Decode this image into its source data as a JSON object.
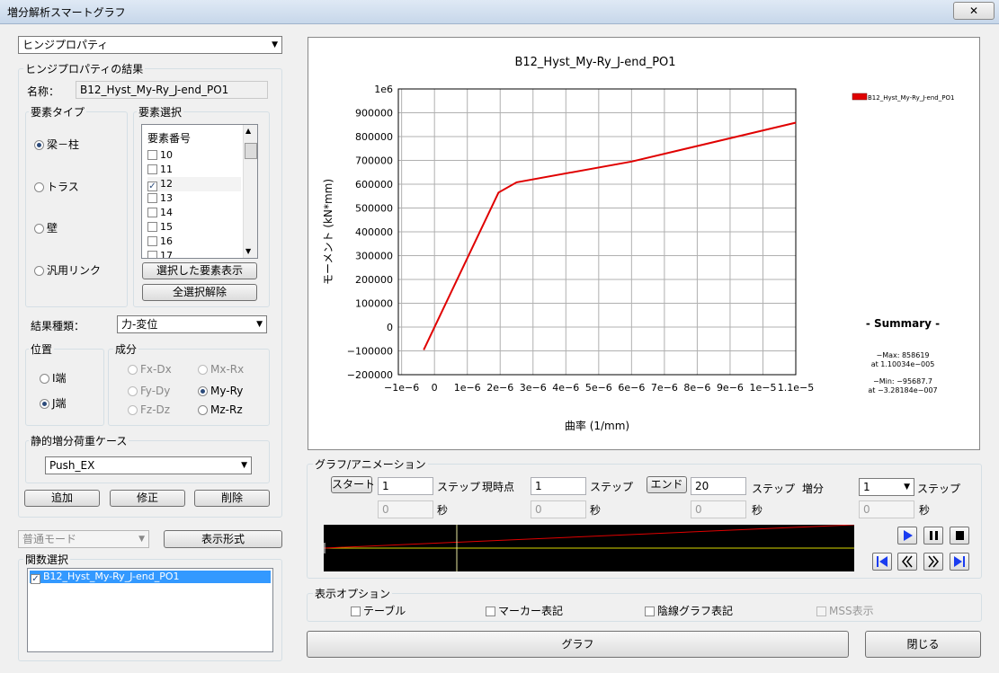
{
  "window": {
    "title": "増分解析スマートグラフ",
    "close": "✕"
  },
  "left": {
    "type_selector": "ヒンジプロパティ",
    "results_group": "ヒンジプロパティの結果",
    "name_label": "名称：",
    "name_value": "B12_Hyst_My-Ry_J-end_PO1",
    "element_type_group": "要素タイプ",
    "element_types": [
      {
        "label": "梁－柱",
        "selected": true
      },
      {
        "label": "トラス",
        "selected": false
      },
      {
        "label": "壁",
        "selected": false
      },
      {
        "label": "汎用リンク",
        "selected": false
      }
    ],
    "element_select_group": "要素選択",
    "element_list_header": "要素番号",
    "element_list": [
      {
        "num": "10",
        "checked": false
      },
      {
        "num": "11",
        "checked": false
      },
      {
        "num": "12",
        "checked": true
      },
      {
        "num": "13",
        "checked": false
      },
      {
        "num": "14",
        "checked": false
      },
      {
        "num": "15",
        "checked": false
      },
      {
        "num": "16",
        "checked": false
      },
      {
        "num": "17",
        "checked": false
      }
    ],
    "show_selected_btn": "選択した要素表示",
    "clear_all_btn": "全選択解除",
    "result_kind_label": "結果種類：",
    "result_kind_value": "力-変位",
    "position_group": "位置",
    "positions": [
      {
        "label": "I端",
        "selected": false
      },
      {
        "label": "J端",
        "selected": true
      }
    ],
    "component_group": "成分",
    "components": [
      {
        "label": "Fx-Dx",
        "selected": false,
        "enabled": false
      },
      {
        "label": "Mx-Rx",
        "selected": false,
        "enabled": false
      },
      {
        "label": "Fy-Dy",
        "selected": false,
        "enabled": false
      },
      {
        "label": "My-Ry",
        "selected": true,
        "enabled": true
      },
      {
        "label": "Fz-Dz",
        "selected": false,
        "enabled": false
      },
      {
        "label": "Mz-Rz",
        "selected": false,
        "enabled": true
      }
    ],
    "load_case_group": "静的増分荷重ケース",
    "load_case_value": "Push_EX",
    "add_btn": "追加",
    "modify_btn": "修正",
    "delete_btn": "削除",
    "mode_value": "普通モード",
    "display_format_btn": "表示形式",
    "function_group": "関数選択",
    "function_item": "B12_Hyst_My-Ry_J-end_PO1"
  },
  "chart_data": {
    "type": "line",
    "title": "B12_Hyst_My-Ry_J-end_PO1",
    "xlabel": "曲率 (1/mm)",
    "ylabel": "モーメント (kN*mm)",
    "xlim": [
      -1.1e-06,
      1.1e-05
    ],
    "ylim": [
      -200000,
      1000000
    ],
    "grid": true,
    "legend": "top-right",
    "x_ticks": [
      -1e-06,
      0,
      1e-06,
      2e-06,
      3e-06,
      4e-06,
      5e-06,
      6e-06,
      7e-06,
      8e-06,
      9e-06,
      1e-05,
      1.1e-05
    ],
    "x_tick_labels": [
      "−1e−6",
      "0",
      "1e−6",
      "2e−6",
      "3e−6",
      "4e−6",
      "5e−6",
      "6e−6",
      "7e−6",
      "8e−6",
      "9e−6",
      "1e−5",
      "1.1e−5"
    ],
    "y_ticks": [
      -200000,
      -100000,
      0,
      100000,
      200000,
      300000,
      400000,
      500000,
      600000,
      700000,
      800000,
      900000,
      1000000
    ],
    "y_tick_labels": [
      "−200000",
      "−100000",
      "0",
      "100000",
      "200000",
      "300000",
      "400000",
      "500000",
      "600000",
      "700000",
      "800000",
      "900000",
      "1e6"
    ],
    "series": [
      {
        "name": "B12_Hyst_My-Ry_J-end_PO1",
        "color": "#e00000",
        "x": [
          -3.28184e-07,
          1.95e-06,
          2.5e-06,
          6e-06,
          1.10034e-05
        ],
        "y": [
          -95687.7,
          565000,
          608000,
          695000,
          858619
        ]
      }
    ],
    "summary_title": "- Summary -",
    "summary_max": "−Max: 858619",
    "summary_max_at": "at 1.10034e−005",
    "summary_min": "−Min: −95687.7",
    "summary_min_at": "at −3.28184e−007"
  },
  "animation": {
    "group": "グラフ/アニメーション",
    "start_btn": "スタート",
    "start_step": "1",
    "start_sec": "0",
    "step_label": "ステップ",
    "current_label": "現時点",
    "current_step": "1",
    "current_sec": "0",
    "end_btn": "エンド",
    "end_step": "20",
    "end_sec": "0",
    "increment_label": "増分",
    "increment_value": "1",
    "increment_sec": "0",
    "sec_label": "秒",
    "track_progress": 0.22
  },
  "options": {
    "group": "表示オプション",
    "table": "テーブル",
    "marker": "マーカー表記",
    "hidden_line": "陰線グラフ表記",
    "mss": "MSS表示"
  },
  "footer": {
    "graph_btn": "グラフ",
    "close_btn": "閉じる"
  }
}
